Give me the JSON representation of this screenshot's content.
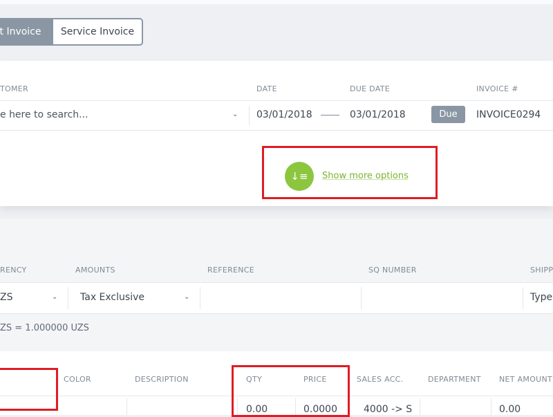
{
  "invoice_tabs": [
    {
      "label": "t Invoice",
      "active": true
    },
    {
      "label": "Service Invoice",
      "active": false
    }
  ],
  "header": {
    "customer_label": "TOMER",
    "customer_placeholder": "e here to search...",
    "date_label": "DATE",
    "date_value": "03/01/2018",
    "due_date_label": "DUE DATE",
    "due_date_value": "03/01/2018",
    "due_badge": "Due",
    "invoice_label": "INVOICE #",
    "invoice_value": "INVOICE0294"
  },
  "more_options": {
    "label": "Show more options",
    "icon": "sort-list-icon",
    "accent": "#8cc63f"
  },
  "options": {
    "currency_label": "RENCY",
    "currency_value": "ZS",
    "amounts_label": "AMOUNTS",
    "amounts_value": "Tax Exclusive",
    "reference_label": "REFERENCE",
    "sq_label": "SQ NUMBER",
    "shipping_label": "SHIPP",
    "shipping_value": "Type",
    "rate_text": "ZS = 1.000000 UZS"
  },
  "table": {
    "columns": [
      "COLOR",
      "DESCRIPTION",
      "QTY",
      "PRICE",
      "SALES ACC.",
      "DEPARTMENT",
      "NET AMOUNT"
    ],
    "row": {
      "qty": "0.00",
      "price": "0.0000",
      "sales_acc": "4000 -> S",
      "net_amount": "0.00"
    }
  },
  "highlight_color": "#e01b24"
}
